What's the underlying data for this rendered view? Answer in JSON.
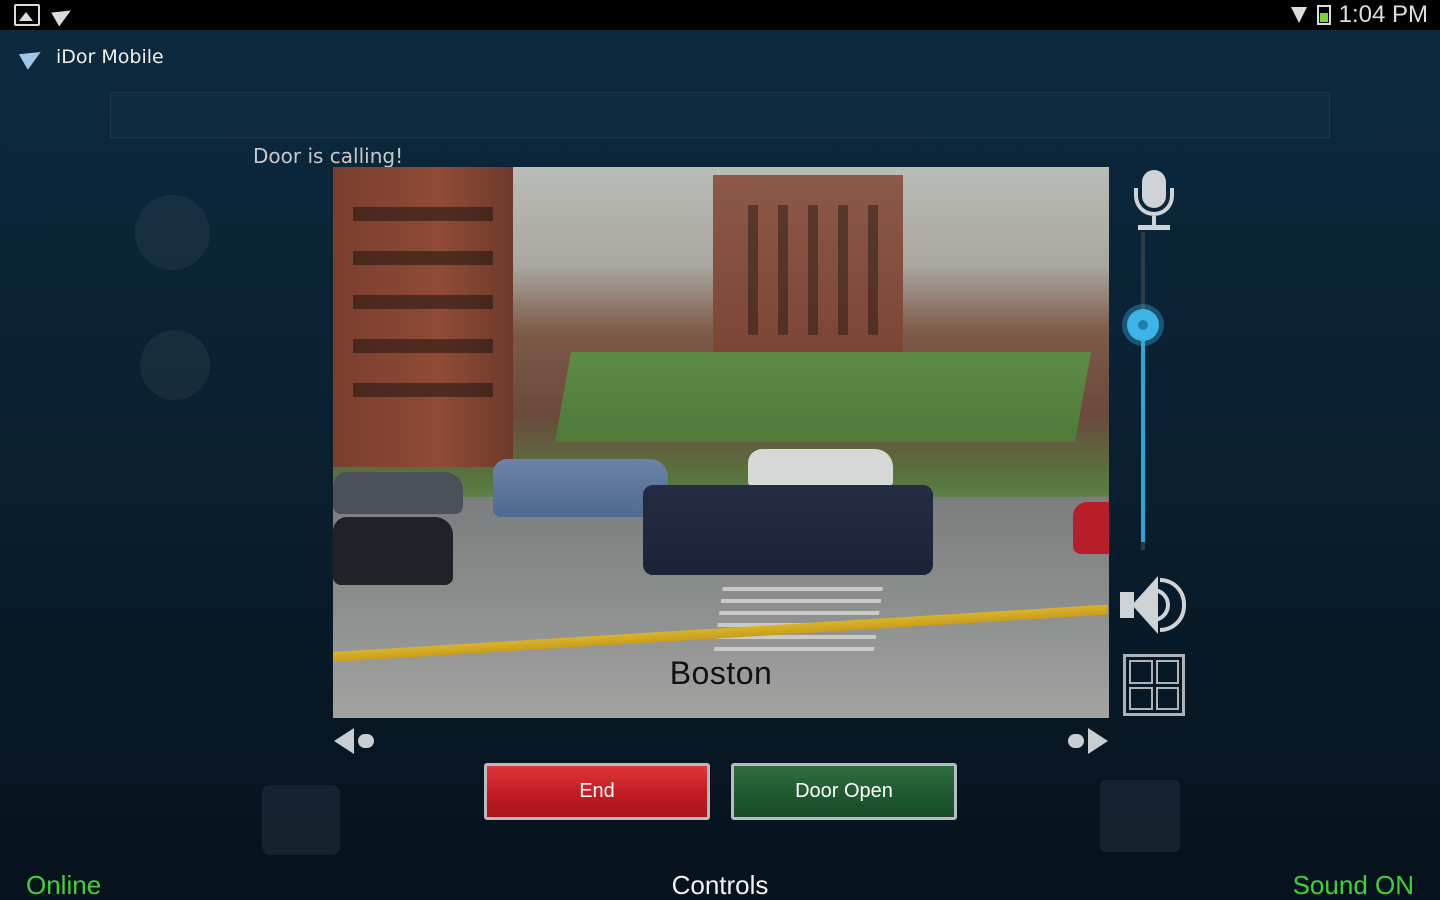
{
  "status_bar": {
    "left_icons": [
      "gallery-icon",
      "app-notification-icon",
      "video-icon"
    ],
    "time": "1:04 PM",
    "right_icons": [
      "wifi-icon",
      "battery-icon"
    ],
    "battery_color": "#7ad23a"
  },
  "app": {
    "title": "iDor Mobile",
    "logo_icon": "idor-logo-icon"
  },
  "call": {
    "status_text": "Door is calling!",
    "camera_caption": "Boston"
  },
  "controls": {
    "mic_icon": "microphone-icon",
    "volume_level": 0.72,
    "speaker_icon": "speaker-icon",
    "layout_icon": "grid-layout-icon",
    "prev_icon": "previous-camera-icon",
    "next_icon": "next-camera-icon",
    "end_label": "End",
    "door_open_label": "Door Open",
    "accent_color": "#3bb5e6"
  },
  "footer": {
    "connection_status": "Online",
    "section_label": "Controls",
    "sound_status": "Sound ON",
    "status_color": "#3ed23a"
  }
}
